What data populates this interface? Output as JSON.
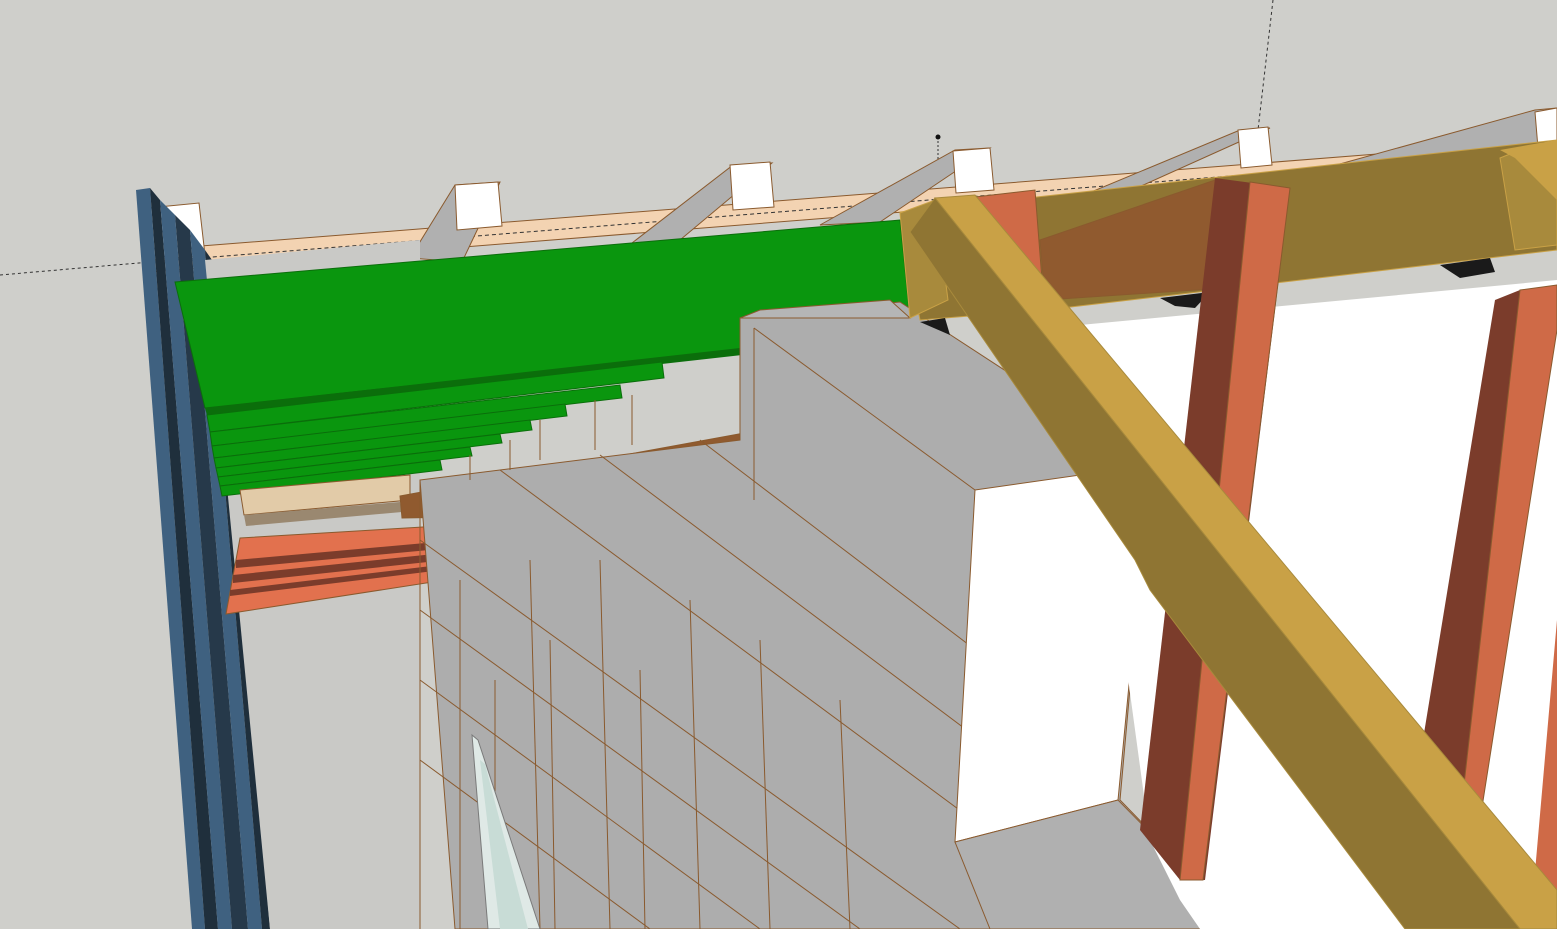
{
  "app": {
    "viewport_label": ""
  },
  "colors": {
    "background": "#cfcfcb",
    "wall_gray": "#adadad",
    "wall_face": "#b5b5b5",
    "white_face": "#ffffff",
    "edge_brown": "#8a5a2e",
    "green_board": "#0a960e",
    "green_dark": "#0b6e0b",
    "orange_joist": "#e2714e",
    "orange_end": "#f59a4e",
    "brown_joist": "#905a2f",
    "red_post": "#cf6a47",
    "red_post_dark": "#7b3c2b",
    "yellow_beam": "#c9a146",
    "olive_beam": "#8f7533",
    "ledger_tan": "#f3d3b2",
    "blue_post": "#3f6180",
    "blue_post_dark": "#1f2f3c",
    "axis_dash": "#333333"
  },
  "scene": {
    "components": [
      "blue-steel-column",
      "green-deck-boards",
      "orange-joists",
      "brown-cantilever-beam",
      "gray-concrete-block-wall",
      "white-block-face",
      "yellow-diagonal-brace",
      "red-posts",
      "olive-top-beam",
      "rafter-tails",
      "tan-ledger",
      "window-opening"
    ]
  }
}
